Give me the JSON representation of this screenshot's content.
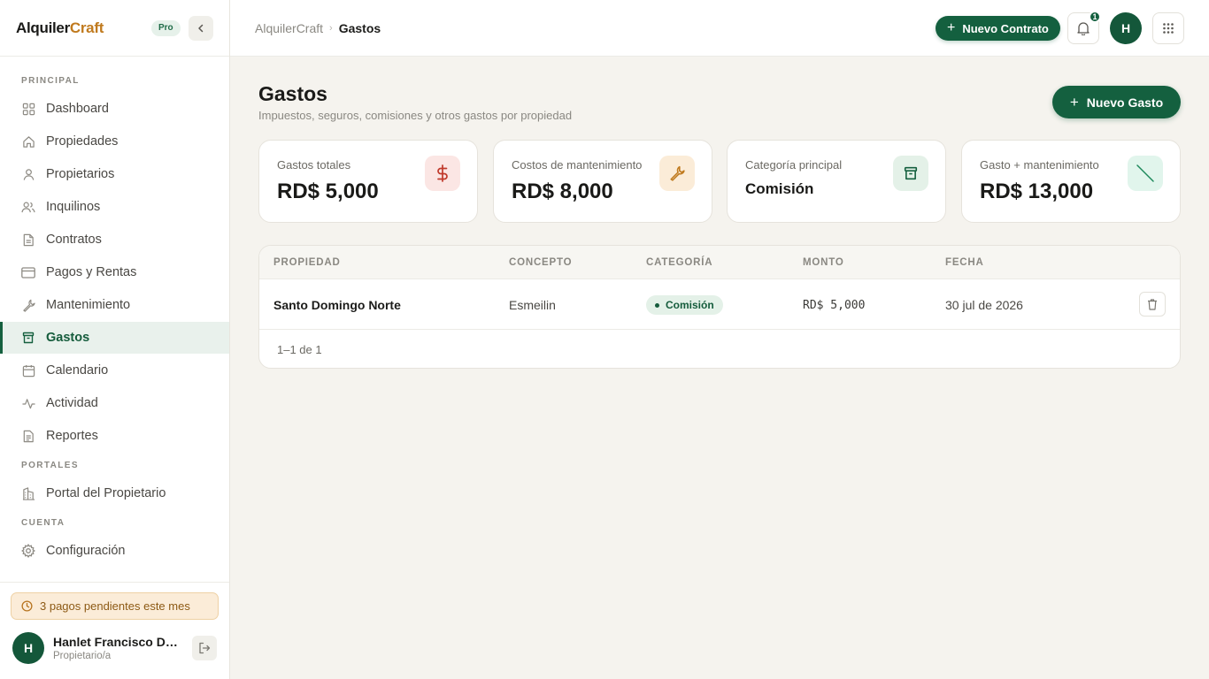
{
  "app": {
    "logo_main": "Alquiler",
    "logo_accent": "Craft",
    "plan_badge": "Pro"
  },
  "sidebar": {
    "sections": {
      "principal": "PRINCIPAL",
      "portales": "PORTALES",
      "cuenta": "CUENTA"
    },
    "items": [
      {
        "label": "Dashboard",
        "icon": "grid-icon"
      },
      {
        "label": "Propiedades",
        "icon": "home-icon"
      },
      {
        "label": "Propietarios",
        "icon": "user-icon"
      },
      {
        "label": "Inquilinos",
        "icon": "users-icon"
      },
      {
        "label": "Contratos",
        "icon": "document-icon"
      },
      {
        "label": "Pagos y Rentas",
        "icon": "credit-card-icon"
      },
      {
        "label": "Mantenimiento",
        "icon": "wrench-icon"
      },
      {
        "label": "Gastos",
        "icon": "archive-icon",
        "active": true
      },
      {
        "label": "Calendario",
        "icon": "calendar-icon"
      },
      {
        "label": "Actividad",
        "icon": "activity-icon"
      },
      {
        "label": "Reportes",
        "icon": "report-icon"
      }
    ],
    "portal_items": [
      {
        "label": "Portal del Propietario",
        "icon": "building-icon"
      }
    ],
    "account_items": [
      {
        "label": "Configuración",
        "icon": "gear-icon"
      }
    ],
    "pending_notice": "3 pagos pendientes este mes",
    "user": {
      "initial": "H",
      "name": "Hanlet Francisco De L...",
      "role": "Propietario/a"
    }
  },
  "topbar": {
    "breadcrumb_root": "AlquilerCraft",
    "breadcrumb_current": "Gastos",
    "new_contract_label": "Nuevo Contrato",
    "notification_count": "1",
    "avatar_initial": "H"
  },
  "main": {
    "title": "Gastos",
    "subtitle": "Impuestos, seguros, comisiones y otros gastos por propiedad",
    "new_expense_label": "Nuevo Gasto",
    "stats": [
      {
        "label": "Gastos totales",
        "value": "RD$ 5,000",
        "icon": "dollar-icon",
        "color": "#c0392b",
        "bg": "#fbe6e4"
      },
      {
        "label": "Costos de mantenimiento",
        "value": "RD$ 8,000",
        "icon": "wrench-icon",
        "color": "#c07a1e",
        "bg": "#fbecd8"
      },
      {
        "label": "Categoría principal",
        "value": "Comisión",
        "icon": "archive-icon",
        "color": "#15603f",
        "bg": "#e4f1e8"
      },
      {
        "label": "Gasto + mantenimiento",
        "value": "RD$ 13,000",
        "icon": "trend-line-icon",
        "color": "#1f8a5c",
        "bg": "#e1f5ec"
      }
    ],
    "table": {
      "columns": [
        "PROPIEDAD",
        "CONCEPTO",
        "CATEGORÍA",
        "MONTO",
        "FECHA"
      ],
      "rows": [
        {
          "propiedad": "Santo Domingo Norte",
          "concepto": "Esmeilin",
          "categoria": "Comisión",
          "monto": "RD$ 5,000",
          "fecha": "30 jul de 2026"
        }
      ],
      "pagination": "1–1 de 1"
    }
  },
  "colors": {
    "brand": "#14603f",
    "accent": "#c07a1e",
    "background": "#f5f3ee"
  }
}
